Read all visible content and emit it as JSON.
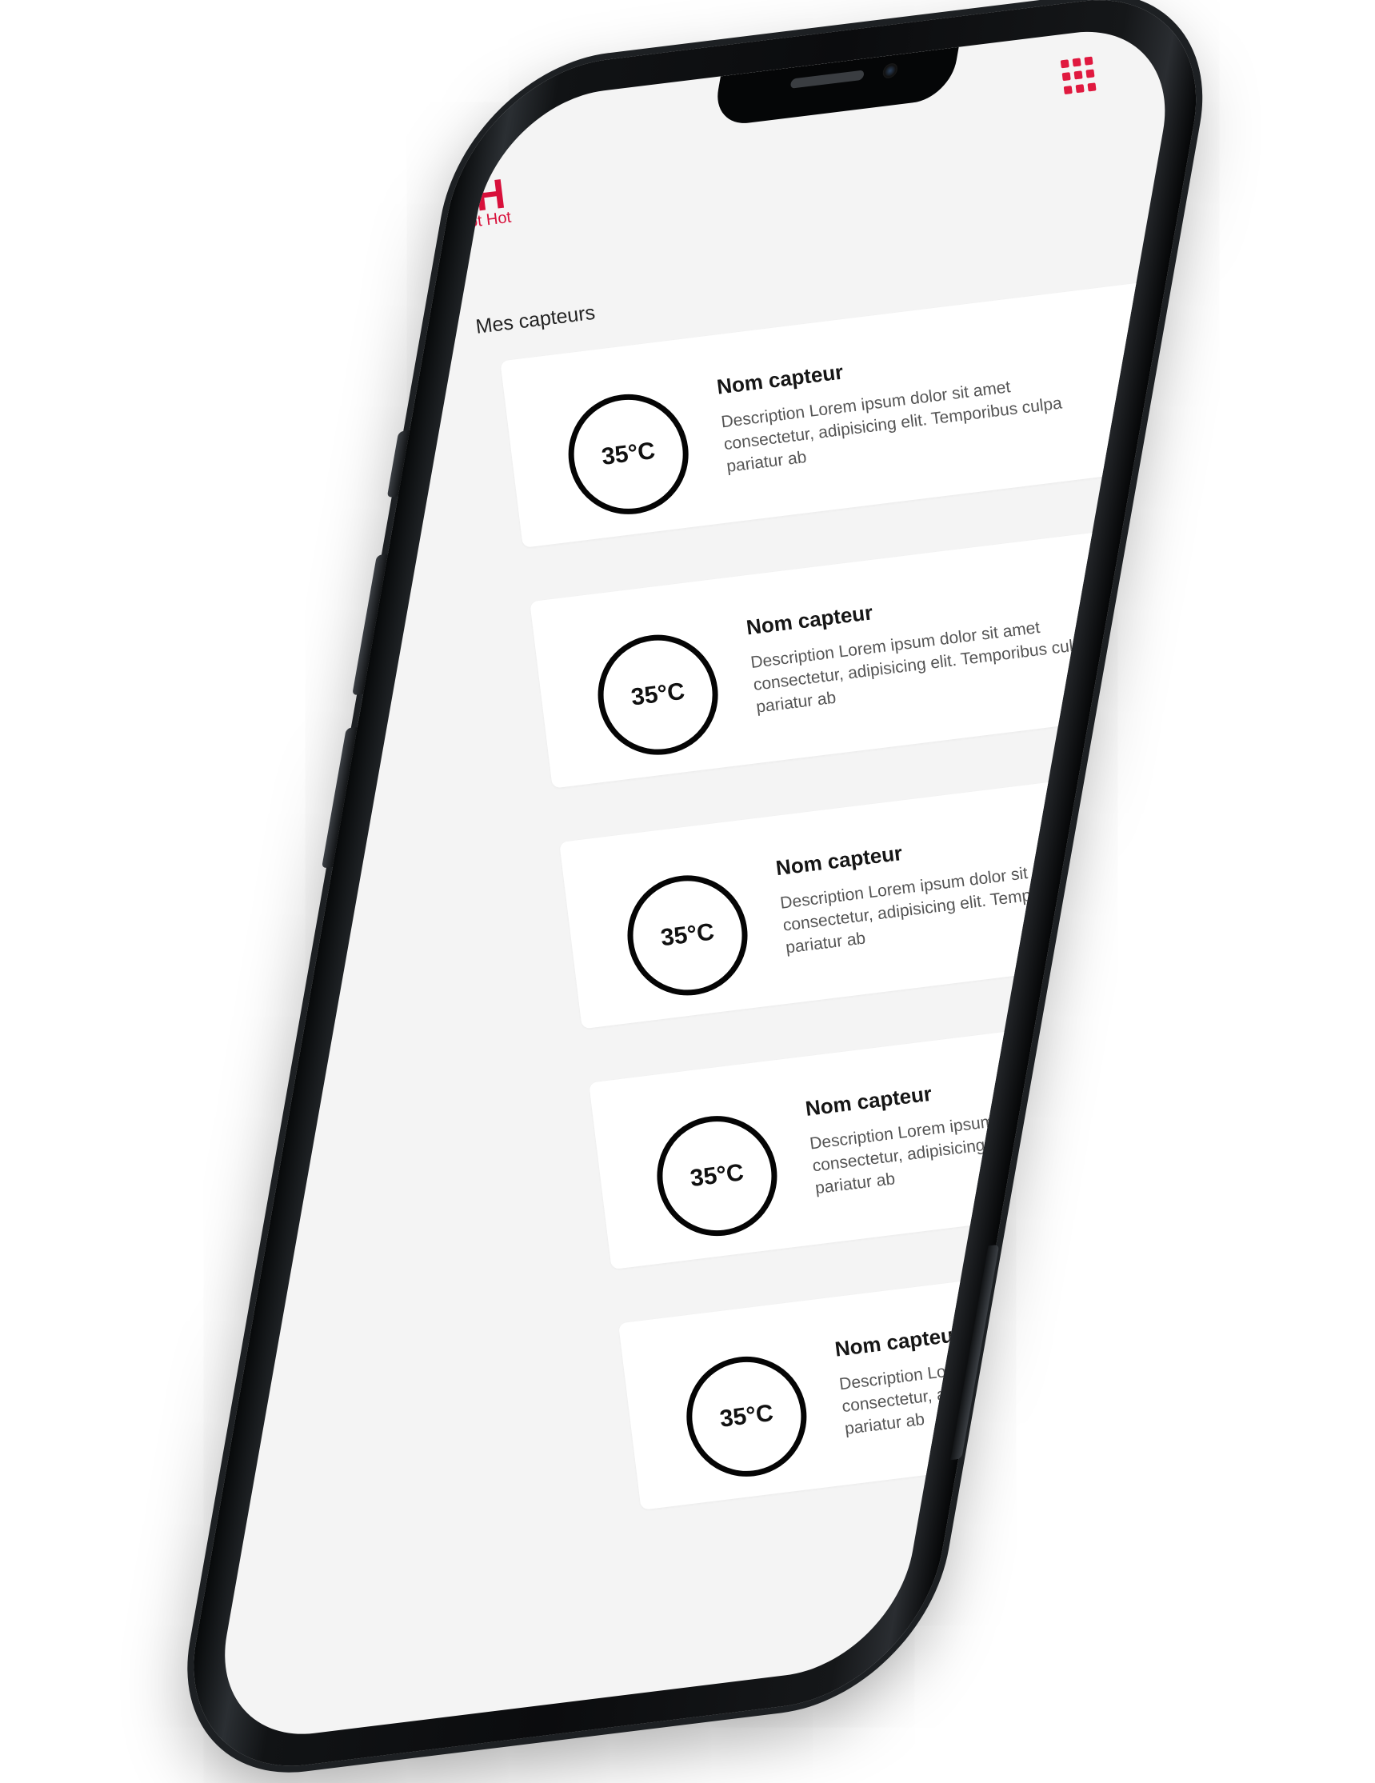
{
  "app": {
    "logo_mark": "HHH",
    "logo_text": "Hot Hot Hot",
    "brand_color": "#d8103b",
    "menu_icon": "grid-menu-icon"
  },
  "main": {
    "section_title": "Mes capteurs",
    "sensors": [
      {
        "name": "Nom capteur",
        "temperature": "35°C",
        "description": "Description Lorem ipsum dolor sit amet consectetur, adipisicing elit. Temporibus culpa pariatur ab"
      },
      {
        "name": "Nom capteur",
        "temperature": "35°C",
        "description": "Description Lorem ipsum dolor sit amet consectetur, adipisicing elit. Temporibus culpa pariatur ab"
      },
      {
        "name": "Nom capteur",
        "temperature": "35°C",
        "description": "Description Lorem ipsum dolor sit amet consectetur, adipisicing elit. Temporibus culpa pariatur ab"
      },
      {
        "name": "Nom capteur",
        "temperature": "35°C",
        "description": "Description Lorem ipsum dolor sit amet consectetur, adipisicing elit. Temporibus culpa pariatur ab"
      },
      {
        "name": "Nom capteur",
        "temperature": "35°C",
        "description": "Description Lorem ipsum dolor sit amet consectetur, adipisicing elit. Temporibus culpa pariatur ab"
      }
    ]
  }
}
